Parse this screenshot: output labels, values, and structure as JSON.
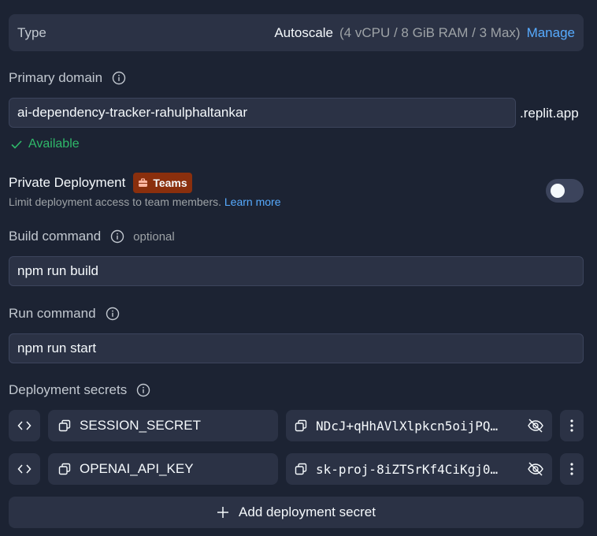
{
  "type_row": {
    "label": "Type",
    "value": "Autoscale",
    "detail": "(4 vCPU / 8 GiB RAM / 3 Max)",
    "manage_label": "Manage"
  },
  "primary_domain": {
    "label": "Primary domain",
    "value": "ai-dependency-tracker-rahulphaltankar",
    "suffix": ".replit.app",
    "status": "Available"
  },
  "private_deployment": {
    "title": "Private Deployment",
    "badge": "Teams",
    "description": "Limit deployment access to team members.",
    "learn_more": "Learn more",
    "enabled": false
  },
  "build_command": {
    "label": "Build command",
    "optional": "optional",
    "value": "npm run build"
  },
  "run_command": {
    "label": "Run command",
    "value": "npm run start"
  },
  "deployment_secrets": {
    "label": "Deployment secrets",
    "items": [
      {
        "key": "SESSION_SECRET",
        "value": "NDcJ+qHhAVlXlpkcn5oijPQ…"
      },
      {
        "key": "OPENAI_API_KEY",
        "value": "sk-proj-8iZTSrKf4CiKgj0…"
      }
    ],
    "add_label": "Add deployment secret"
  },
  "colors": {
    "background": "#1c2333",
    "surface": "#2b3245",
    "accent": "#57abff",
    "success": "#2fb96a",
    "badge": "#8a2f0d"
  }
}
